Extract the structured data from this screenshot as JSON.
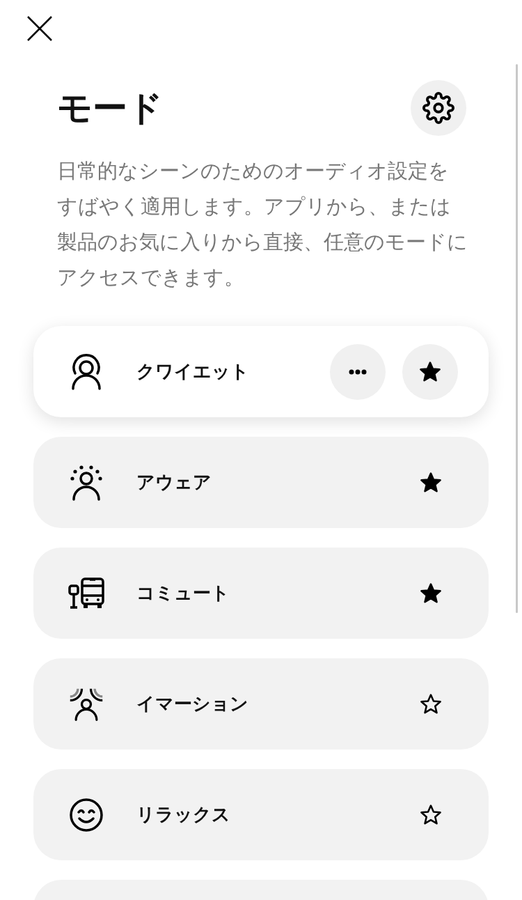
{
  "header": {
    "title": "モード",
    "description": "日常的なシーンのためのオーディオ設定をすばやく適用します。アプリから、または製品のお気に入りから直接、任意のモードにアクセスできます。"
  },
  "modes": [
    {
      "kind": "quiet",
      "label": "クワイエット",
      "selected": true,
      "favorite": true
    },
    {
      "kind": "aware",
      "label": "アウェア",
      "selected": false,
      "favorite": true
    },
    {
      "kind": "commute",
      "label": "コミュート",
      "selected": false,
      "favorite": true
    },
    {
      "kind": "immersion",
      "label": "イマーション",
      "selected": false,
      "favorite": false
    },
    {
      "kind": "relax",
      "label": "リラックス",
      "selected": false,
      "favorite": false
    },
    {
      "kind": "blank",
      "selected": false
    }
  ]
}
